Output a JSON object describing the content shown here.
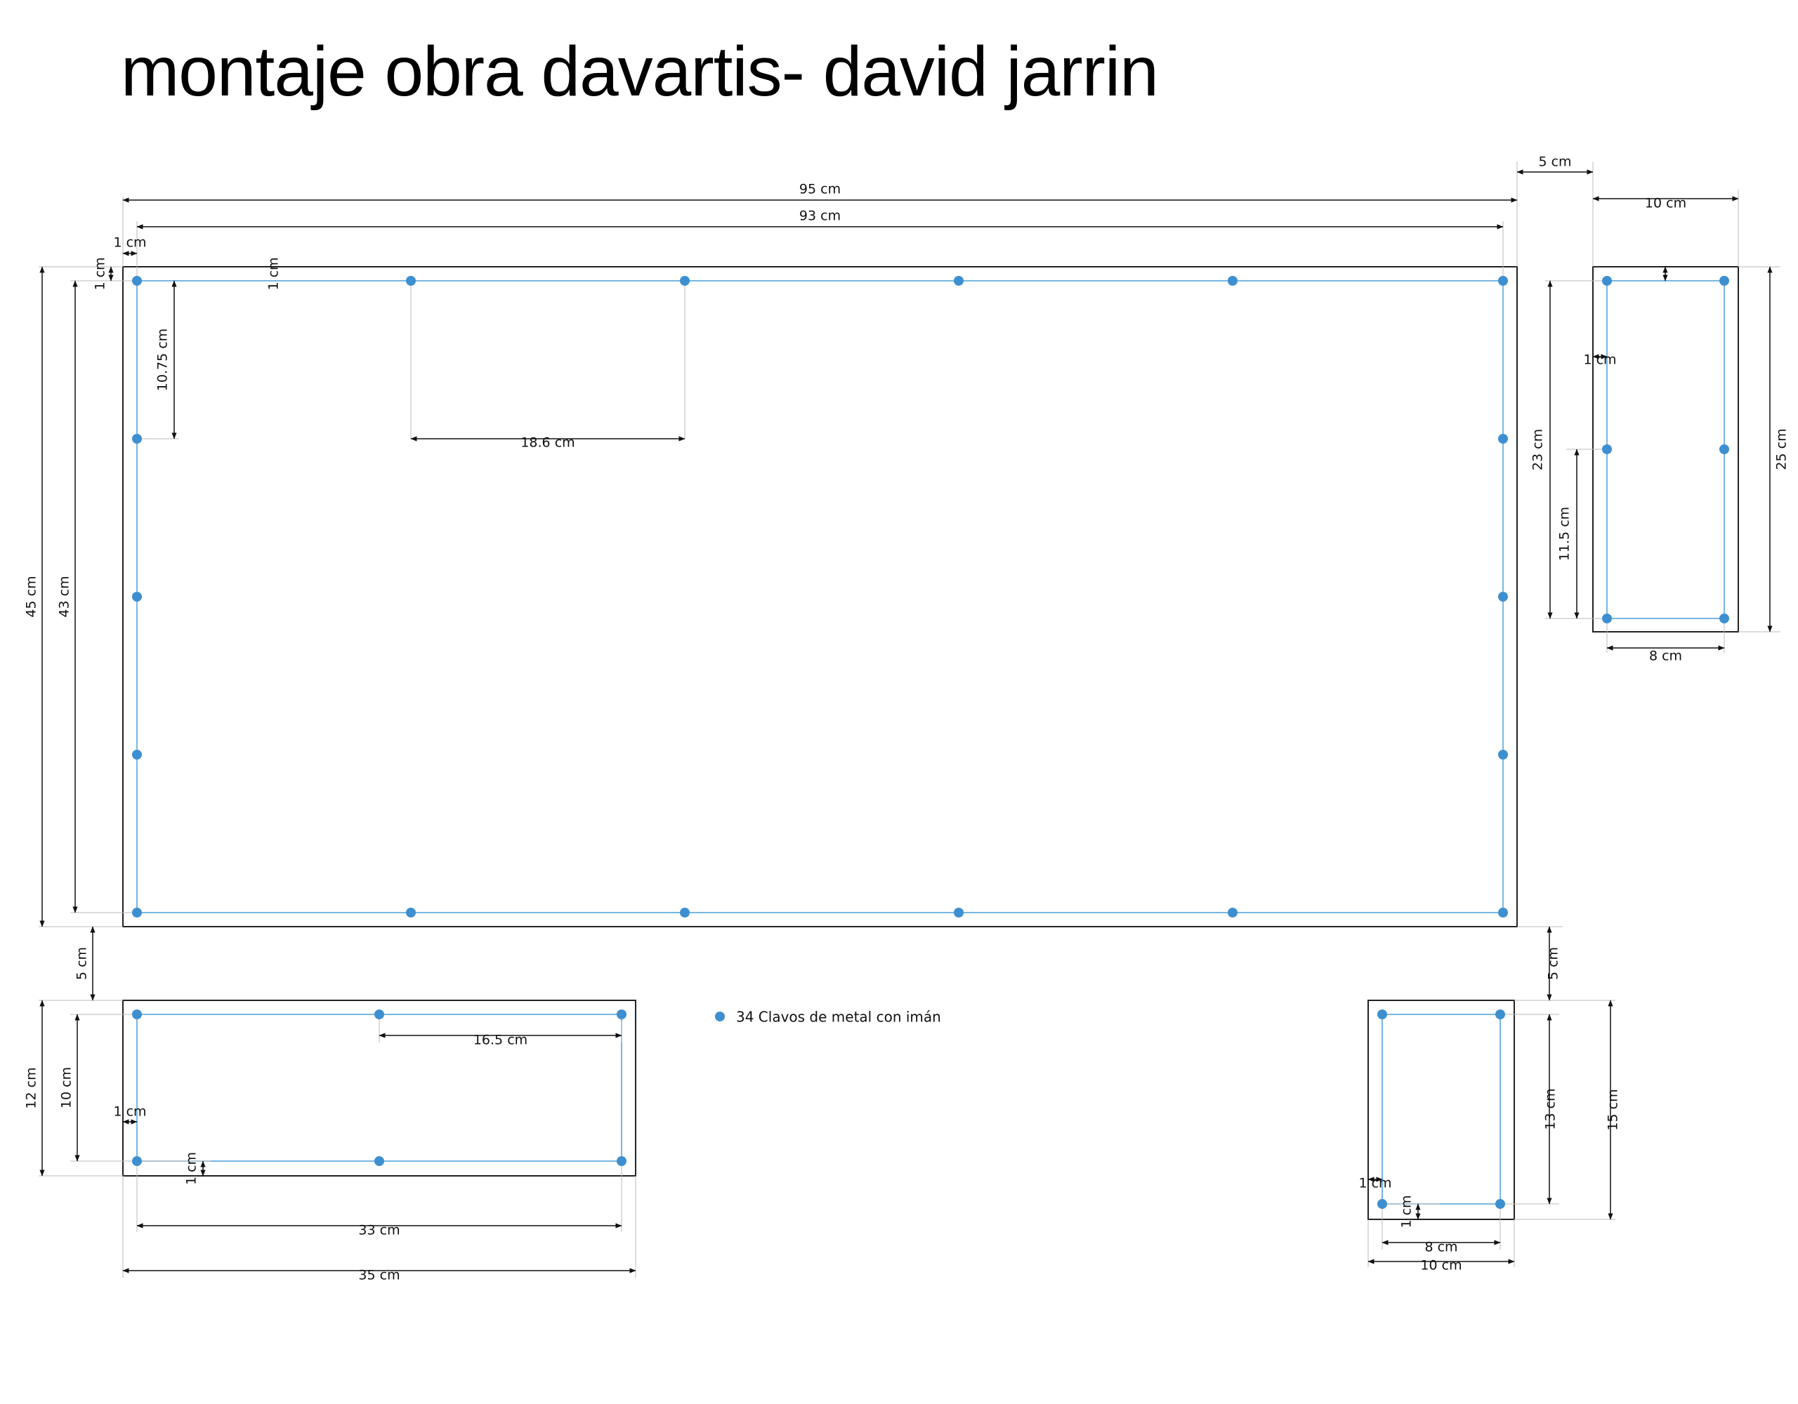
{
  "title": "montaje obra davartis- david jarrin",
  "colors": {
    "frame": "#222222",
    "guide": "#4a9fd8",
    "nail": "#3d8fd0",
    "dim": "#111111"
  },
  "legend": {
    "icon": "blue-dot",
    "text": "34 Clavos de metal con imán"
  },
  "pieces": {
    "large": {
      "dims": {
        "outer_width": "95 cm",
        "inner_width": "93 cm",
        "margin_h": "1 cm",
        "margin_v": "1 cm",
        "nail_vertical_spacing": "10.75 cm",
        "nail_horizontal_spacing": "18.6 cm",
        "outer_height": "45 cm",
        "inner_height": "43 cm"
      }
    },
    "small_right": {
      "dims": {
        "gap": "5 cm",
        "outer_width": "10 cm",
        "margin_top": "1 cm",
        "margin_side": "1 cm",
        "inner_height": "23 cm",
        "nail_vertical_spacing": "11.5 cm",
        "outer_height": "25 cm",
        "inner_width": "8 cm"
      }
    },
    "bottom_left": {
      "dims": {
        "gap": "5 cm",
        "outer_height": "12 cm",
        "inner_height": "10 cm",
        "margin_side": "1 cm",
        "margin_bottom": "1 cm",
        "nail_horizontal_spacing": "16.5 cm",
        "inner_width": "33 cm",
        "outer_width": "35 cm"
      }
    },
    "bottom_right": {
      "dims": {
        "gap": "5 cm",
        "inner_height": "13 cm",
        "outer_height": "15 cm",
        "margin_side": "1 cm",
        "margin_bottom": "1 cm",
        "inner_width": "8 cm",
        "outer_width": "10 cm"
      }
    }
  }
}
